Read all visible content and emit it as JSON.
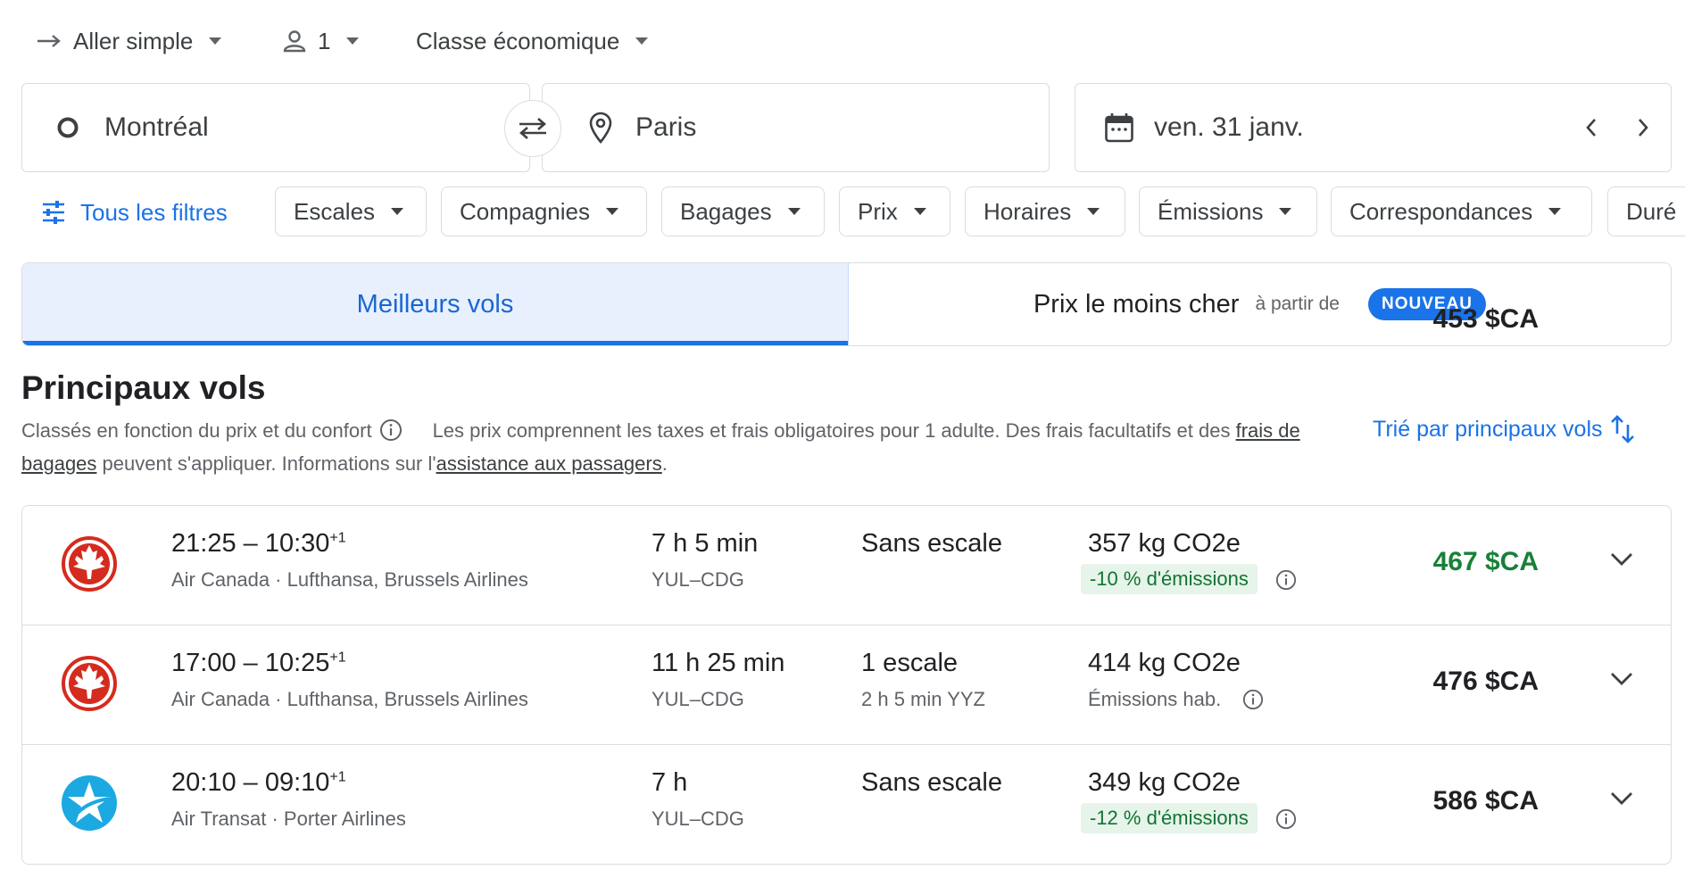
{
  "trip": {
    "type_label": "Aller simple",
    "passengers": "1",
    "cabin_class": "Classe économique"
  },
  "search": {
    "origin": "Montréal",
    "destination": "Paris",
    "date": "ven. 31 janv."
  },
  "filters": {
    "all_filters_label": "Tous les filtres",
    "chips": [
      "Escales",
      "Compagnies",
      "Bagages",
      "Prix",
      "Horaires",
      "Émissions",
      "Correspondances",
      "Duré"
    ]
  },
  "tabs": {
    "best_label": "Meilleurs vols",
    "cheapest_label": "Prix le moins cher",
    "cheapest_from": "à partir de",
    "cheapest_price": "453 $CA",
    "new_badge": "NOUVEAU"
  },
  "results": {
    "title": "Principaux vols",
    "ranking_note": "Classés en fonction du prix et du confort",
    "price_note_1": "Les prix comprennent les taxes et frais obligatoires pour 1 adulte. Des frais facultatifs et des ",
    "baggage_fees_link": "frais de bagages",
    "price_note_2": " peuvent s'appliquer. Informations sur l'",
    "assistance_link": "assistance aux passagers",
    "price_note_3": ".",
    "sort_label": "Trié par principaux vols"
  },
  "flights": [
    {
      "logo": "air-canada-maple-leaf",
      "departure": "21:25",
      "arrival": "10:30",
      "day_offset": "+1",
      "airlines": "Air Canada · Lufthansa, Brussels Airlines",
      "duration": "7 h 5 min",
      "route": "YUL–CDG",
      "stops": "Sans escale",
      "stop_detail": "",
      "emissions": "357 kg CO2e",
      "emissions_note": "-10 % d'émissions",
      "emissions_note_style": "badge",
      "price": "467 $CA",
      "price_color": "#188038"
    },
    {
      "logo": "air-canada-maple-leaf",
      "departure": "17:00",
      "arrival": "10:25",
      "day_offset": "+1",
      "airlines": "Air Canada · Lufthansa, Brussels Airlines",
      "duration": "11 h 25 min",
      "route": "YUL–CDG",
      "stops": "1 escale",
      "stop_detail": "2 h 5 min YYZ",
      "emissions": "414 kg CO2e",
      "emissions_note": "Émissions hab.",
      "emissions_note_style": "plain",
      "price": "476 $CA",
      "price_color": "#202124"
    },
    {
      "logo": "air-transat-star",
      "departure": "20:10",
      "arrival": "09:10",
      "day_offset": "+1",
      "airlines": "Air Transat · Porter Airlines",
      "duration": "7 h",
      "route": "YUL–CDG",
      "stops": "Sans escale",
      "stop_detail": "",
      "emissions": "349 kg CO2e",
      "emissions_note": "-12 % d'émissions",
      "emissions_note_style": "badge",
      "price": "586 $CA",
      "price_color": "#202124"
    }
  ],
  "colors": {
    "accent": "#1a73e8",
    "selected_tab_bg": "#e8f0fe",
    "good_price": "#188038",
    "eco_badge_bg": "#e6f4ea",
    "air_canada_red": "#d52b1e",
    "air_transat_blue": "#1ca9e1"
  }
}
